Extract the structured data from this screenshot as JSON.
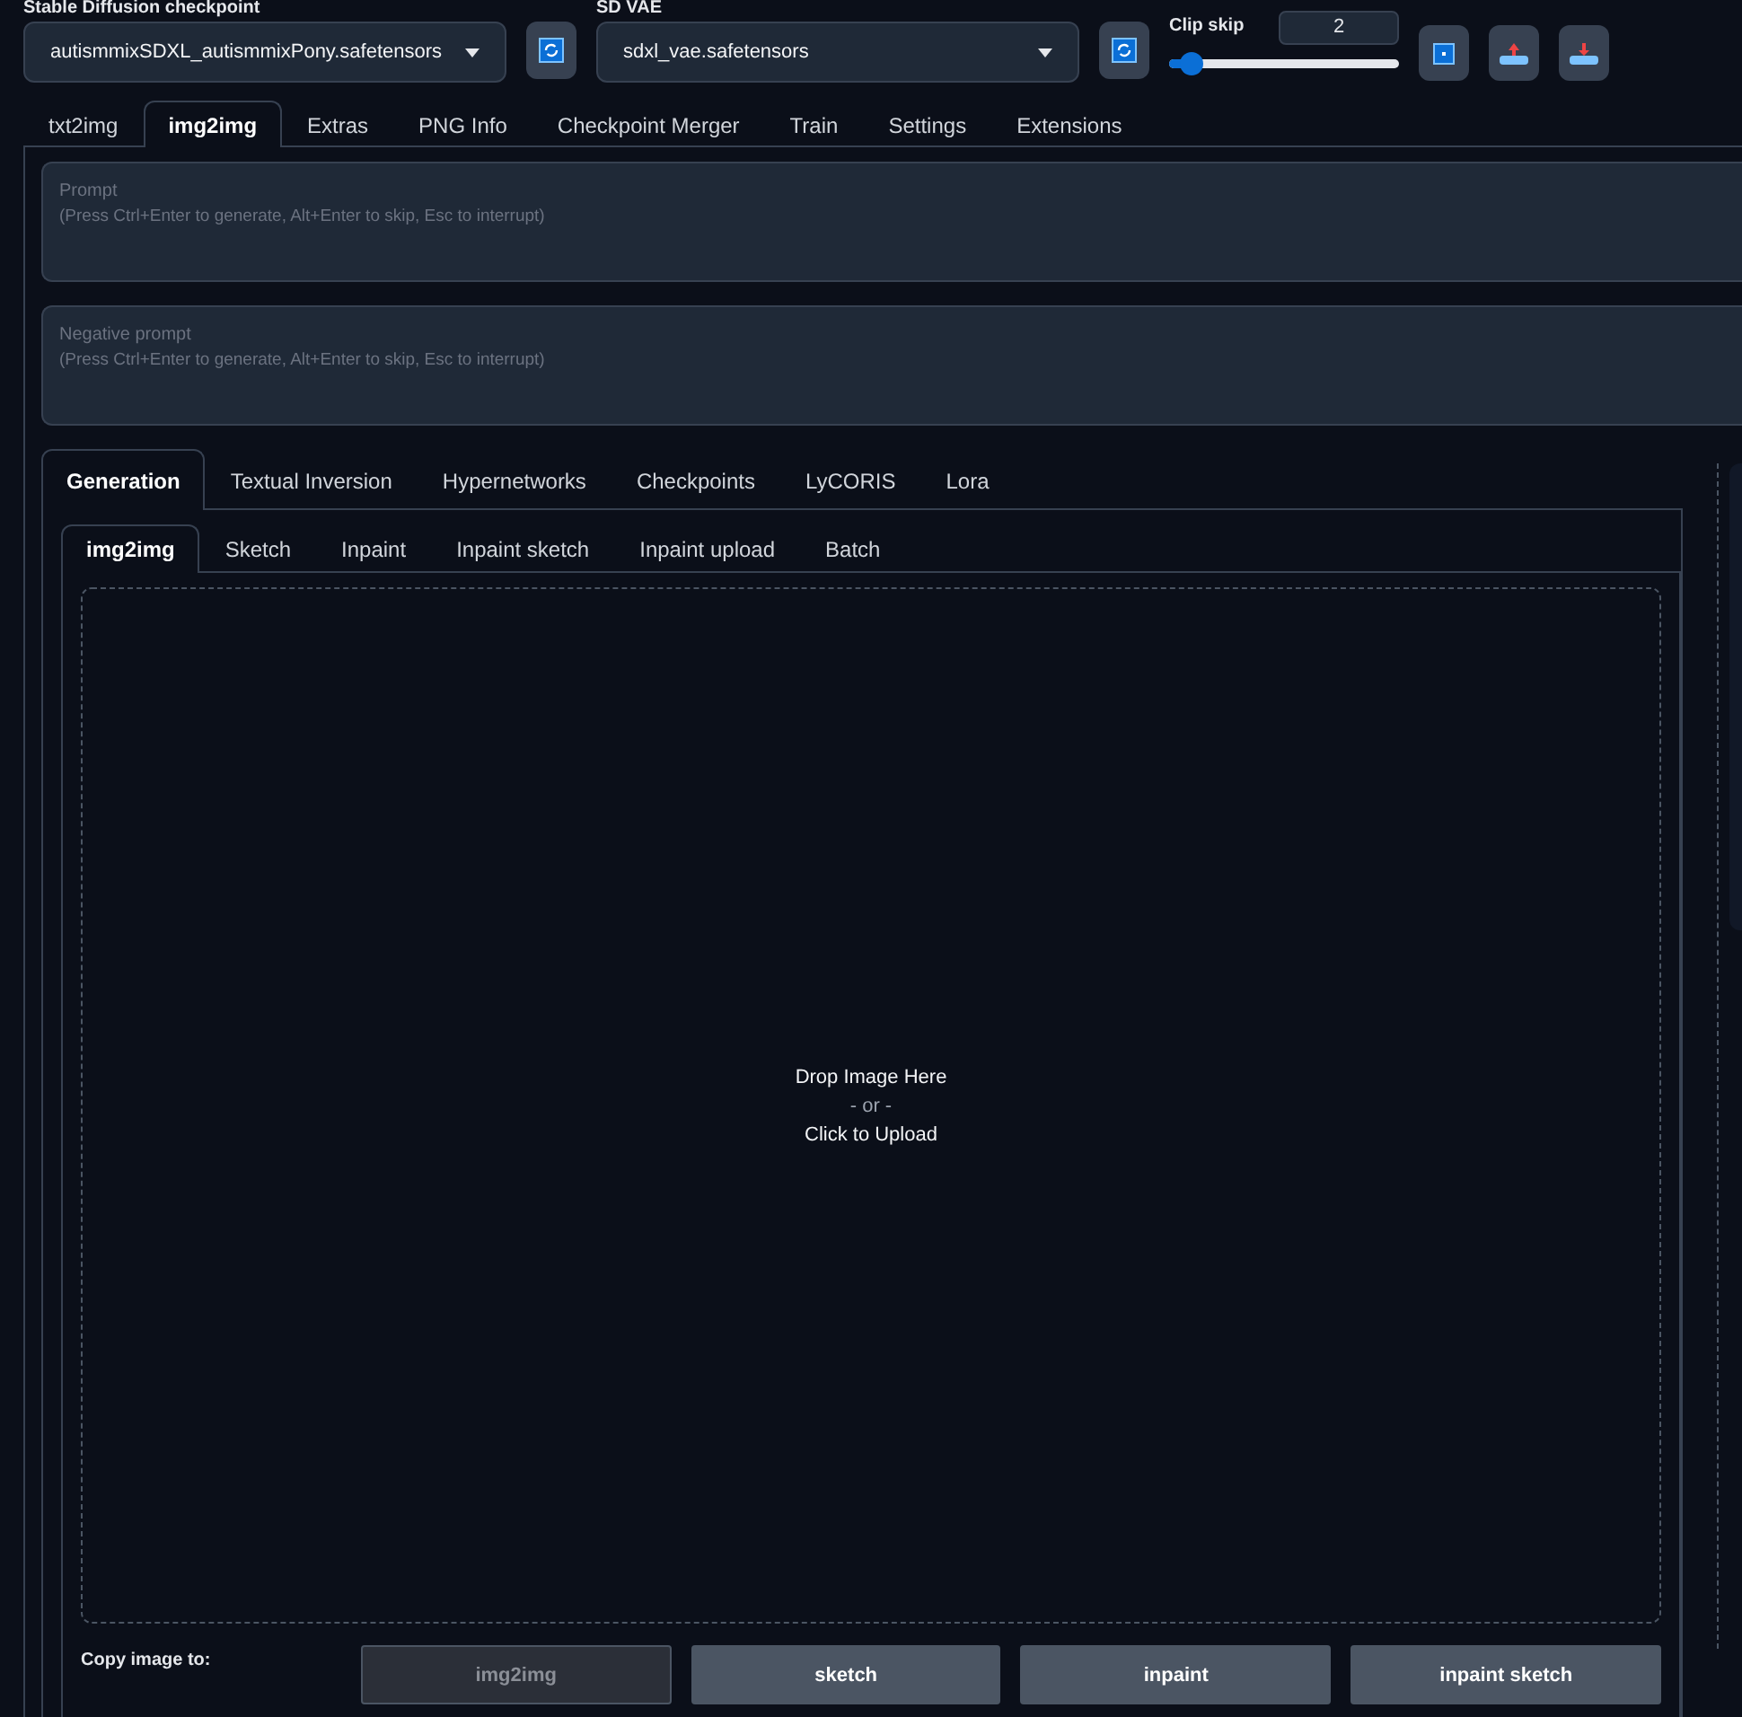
{
  "top_bar": {
    "checkpoint": {
      "label": "Stable Diffusion checkpoint",
      "value": "autismmixSDXL_autismmixPony.safetensors"
    },
    "vae": {
      "label": "SD VAE",
      "value": "sdxl_vae.safetensors"
    },
    "clip_skip": {
      "label": "Clip skip",
      "value": "2",
      "level": 0.09
    }
  },
  "main_tabs": [
    {
      "label": "txt2img",
      "selected": false
    },
    {
      "label": "img2img",
      "selected": true
    },
    {
      "label": "Extras",
      "selected": false
    },
    {
      "label": "PNG Info",
      "selected": false
    },
    {
      "label": "Checkpoint Merger",
      "selected": false
    },
    {
      "label": "Train",
      "selected": false
    },
    {
      "label": "Settings",
      "selected": false
    },
    {
      "label": "Extensions",
      "selected": false
    }
  ],
  "prompt": {
    "label": "Prompt",
    "placeholder": "(Press Ctrl+Enter to generate, Alt+Enter to skip, Esc to interrupt)"
  },
  "negative_prompt": {
    "label": "Negative prompt",
    "placeholder": "(Press Ctrl+Enter to generate, Alt+Enter to skip, Esc to interrupt)"
  },
  "extra_tabs": [
    {
      "label": "Generation",
      "selected": true
    },
    {
      "label": "Textual Inversion",
      "selected": false
    },
    {
      "label": "Hypernetworks",
      "selected": false
    },
    {
      "label": "Checkpoints",
      "selected": false
    },
    {
      "label": "LyCORIS",
      "selected": false
    },
    {
      "label": "Lora",
      "selected": false
    }
  ],
  "mode_tabs": [
    {
      "label": "img2img",
      "selected": true
    },
    {
      "label": "Sketch",
      "selected": false
    },
    {
      "label": "Inpaint",
      "selected": false
    },
    {
      "label": "Inpaint sketch",
      "selected": false
    },
    {
      "label": "Inpaint upload",
      "selected": false
    },
    {
      "label": "Batch",
      "selected": false
    }
  ],
  "upload": {
    "line_1": "Drop Image Here",
    "line_2": "- or -",
    "line_3": "Click to Upload"
  },
  "copy_to": {
    "label": "Copy image to:",
    "buttons": [
      {
        "label": "img2img",
        "disabled": true
      },
      {
        "label": "sketch",
        "disabled": false
      },
      {
        "label": "inpaint",
        "disabled": false
      },
      {
        "label": "inpaint sketch",
        "disabled": false
      }
    ]
  }
}
